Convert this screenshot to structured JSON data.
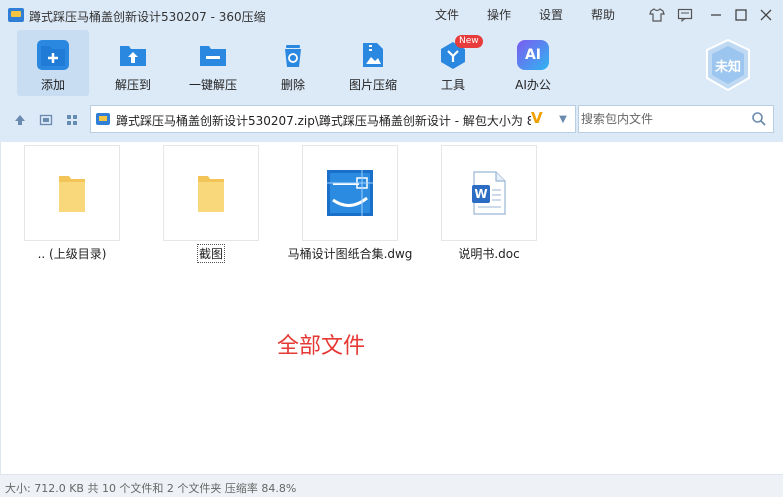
{
  "window": {
    "title": "蹲式踩压马桶盖创新设计530207 - 360压缩",
    "menu": [
      "文件",
      "操作",
      "设置",
      "帮助"
    ]
  },
  "toolbar": {
    "items": [
      {
        "label": "添加",
        "icon": "add-icon"
      },
      {
        "label": "解压到",
        "icon": "extract-to-icon"
      },
      {
        "label": "一键解压",
        "icon": "one-click-extract-icon"
      },
      {
        "label": "删除",
        "icon": "delete-icon"
      },
      {
        "label": "图片压缩",
        "icon": "image-compress-icon"
      },
      {
        "label": "工具",
        "icon": "tools-icon",
        "badge": "New"
      },
      {
        "label": "AI办公",
        "icon": "ai-office-icon",
        "icon_text": "AI"
      }
    ],
    "user_badge": "未知"
  },
  "address": {
    "path": "蹲式踩压马桶盖创新设计530207.zip\\蹲式踩压马桶盖创新设计 - 解包大小为 8"
  },
  "search": {
    "placeholder": "搜索包内文件"
  },
  "files": [
    {
      "name": ".. (上级目录)",
      "type": "folder"
    },
    {
      "name": "截图",
      "type": "folder"
    },
    {
      "name": "马桶设计图纸合集.dwg",
      "type": "dwg"
    },
    {
      "name": "说明书.doc",
      "type": "doc",
      "icon_text": "W"
    }
  ],
  "view_caption": "全部文件",
  "status": {
    "text": "大小: 712.0 KB 共 10 个文件和 2 个文件夹 压缩率 84.8%"
  },
  "colors": {
    "toolbar_bg": "#dce9f7",
    "accent": "#2a88e0",
    "caption": "#e53935"
  }
}
